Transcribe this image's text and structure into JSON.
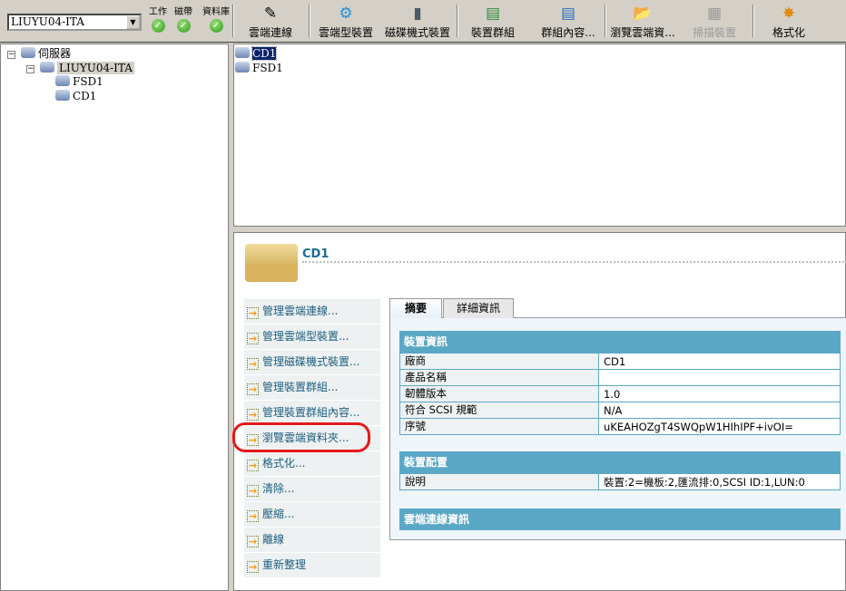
{
  "toolbar": {
    "server": "LIUYU04-ITA",
    "status": [
      {
        "label": "工作"
      },
      {
        "label": "磁帶"
      },
      {
        "label": "資料庫"
      }
    ],
    "buttons": [
      {
        "label": "雲端連線",
        "icon": "cloud-connect-icon"
      },
      {
        "label": "雲端型裝置",
        "icon": "cloud-device-icon"
      },
      {
        "label": "磁碟機式裝置",
        "icon": "disk-device-icon"
      },
      {
        "label": "裝置群組",
        "icon": "device-group-icon"
      },
      {
        "label": "群組內容...",
        "icon": "group-content-icon"
      },
      {
        "label": "瀏覽雲端資...",
        "icon": "browse-cloud-icon"
      },
      {
        "label": "掃描裝置",
        "icon": "scan-device-icon",
        "disabled": true
      },
      {
        "label": "格式化",
        "icon": "format-icon"
      }
    ]
  },
  "tree": {
    "root": "伺服器",
    "server": "LIUYU04-ITA",
    "children": [
      "FSD1",
      "CD1"
    ]
  },
  "list": {
    "items": [
      "CD1",
      "FSD1"
    ],
    "selected": "CD1"
  },
  "detail": {
    "title": "CD1",
    "actions": [
      "管理雲端連線...",
      "管理雲端型裝置...",
      "管理磁碟機式裝置...",
      "管理裝置群組...",
      "管理裝置群組內容...",
      "瀏覽雲端資料夾...",
      "格式化...",
      "清除...",
      "壓縮...",
      "離線",
      "重新整理"
    ],
    "highlighted_action": "瀏覽雲端資料夾...",
    "tabs": [
      "摘要",
      "詳細資訊"
    ],
    "active_tab": "摘要",
    "sections": [
      {
        "title": "裝置資訊",
        "rows": [
          [
            "廠商",
            "CD1"
          ],
          [
            "產品名稱",
            ""
          ],
          [
            "韌體版本",
            "1.0"
          ],
          [
            "符合 SCSI 規範",
            "N/A"
          ],
          [
            "序號",
            "uKEAHOZgT4SWQpW1HIhIPF+ivOI="
          ]
        ]
      },
      {
        "title": "裝置配置",
        "rows": [
          [
            "說明",
            "裝置:2=機板:2,匯流排:0,SCSI ID:1,LUN:0"
          ]
        ]
      },
      {
        "title": "雲端連線資訊",
        "rows": []
      }
    ]
  },
  "colors": {
    "section_header": "#5ba7c6",
    "action_text": "#1d5e7e",
    "highlight_ring": "#e51a1a",
    "selection": "#0a246a"
  }
}
